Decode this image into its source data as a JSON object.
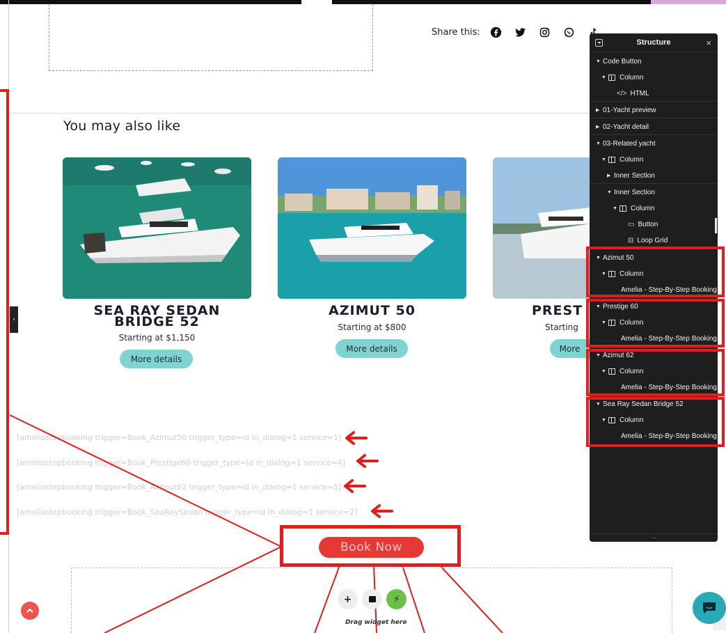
{
  "share": {
    "label": "Share this:",
    "icons": [
      "facebook-icon",
      "twitter-icon",
      "instagram-icon",
      "whatsapp-icon",
      "tiktok-icon"
    ]
  },
  "related": {
    "title": "You may also like",
    "cards": [
      {
        "name_line1": "SEA RAY SEDAN",
        "name_line2": "BRIDGE 52",
        "price": "Starting at $1,150",
        "button": "More details"
      },
      {
        "name_line1": "AZIMUT 50",
        "name_line2": "",
        "price": "Starting at $800",
        "button": "More details"
      },
      {
        "name_line1": "PREST",
        "name_line2": "",
        "price": "Starting",
        "button": "More"
      }
    ]
  },
  "shortcodes": [
    "[ameliastepbooking trigger=Book_Azimut50 trigger_type=id in_dialog=1 service=1]",
    "[ameliastepbooking trigger=Book_Prestige60 trigger_type=id in_dialog=1 service=4]",
    "[ameliastepbooking trigger=Book_Azimut62 trigger_type=id in_dialog=1 service=5]",
    "[ameliastepbooking trigger=Book_SeaRaySedan trigger_type=id in_dialog=1 service=2]"
  ],
  "book_button": "Book Now",
  "drop_zone": {
    "text": "Drag widget here",
    "add": "+"
  },
  "panel": {
    "title": "Structure",
    "close": "×",
    "footer": "...",
    "rows": [
      {
        "label": "Code Button",
        "caret": "▼"
      },
      {
        "label": "Column",
        "caret": "▼"
      },
      {
        "label": "HTML",
        "caret": ""
      },
      {
        "label": "01-Yacht preview",
        "caret": "▶"
      },
      {
        "label": "02-Yacht detail",
        "caret": "▶"
      },
      {
        "label": "03-Related yacht",
        "caret": "▼"
      },
      {
        "label": "Column",
        "caret": "▼"
      },
      {
        "label": "Inner Section",
        "caret": "▶"
      },
      {
        "label": "Inner Section",
        "caret": "▼"
      },
      {
        "label": "Column",
        "caret": "▼"
      },
      {
        "label": "Button",
        "caret": ""
      },
      {
        "label": "Loop Grid",
        "caret": ""
      },
      {
        "label": "Azimut 50",
        "caret": "▼"
      },
      {
        "label": "Column",
        "caret": "▼"
      },
      {
        "label": "Amelia - Step-By-Step Booking",
        "caret": ""
      },
      {
        "label": "Prestige 60",
        "caret": "▼"
      },
      {
        "label": "Column",
        "caret": "▼"
      },
      {
        "label": "Amelia - Step-By-Step Booking",
        "caret": ""
      },
      {
        "label": "Azimut 62",
        "caret": "▼"
      },
      {
        "label": "Column",
        "caret": "▼"
      },
      {
        "label": "Amelia - Step-By-Step Booking",
        "caret": ""
      },
      {
        "label": "Sea Ray Sedan Bridge 52",
        "caret": "▼"
      },
      {
        "label": "Column",
        "caret": "▼"
      },
      {
        "label": "Amelia - Step-By-Step Booking",
        "caret": ""
      }
    ]
  },
  "colors": {
    "accent_red": "#e11d1d",
    "button_teal": "#7fd4d1",
    "book_red": "#e53935",
    "panel_bg": "#1e1e1e"
  }
}
